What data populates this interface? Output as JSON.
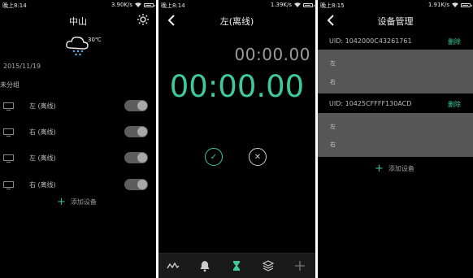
{
  "screen1": {
    "status": {
      "time": "晚上8:14",
      "speed": "3.90K/s"
    },
    "title": "中山",
    "weather": {
      "temp": "30℃"
    },
    "date": "2015/11/19",
    "group": "未分组",
    "devices": [
      {
        "label": "左 (离线)"
      },
      {
        "label": "右 (离线)"
      },
      {
        "label": "左 (离线)"
      },
      {
        "label": "右 (离线)"
      }
    ],
    "add_label": "添加设备"
  },
  "screen2": {
    "status": {
      "time": "晚上8:14",
      "speed": "1.39K/s"
    },
    "title": "左(离线)",
    "small_timer": "00:00.00",
    "big_timer": "00:00.00",
    "confirm_glyph": "✓",
    "cancel_glyph": "✕"
  },
  "screen3": {
    "status": {
      "time": "晚上8:15",
      "speed": "1.91K/s"
    },
    "title": "设备管理",
    "devices": [
      {
        "uid": "UID: 1042000C43261761",
        "delete": "删除",
        "left": "左",
        "right": "右"
      },
      {
        "uid": "UID: 10425CFFFF130ACD",
        "delete": "删除",
        "left": "左",
        "right": "右"
      }
    ],
    "add_label": "添加设备"
  },
  "colors": {
    "accent": "#3fc89b",
    "background": "#000000",
    "panel": "#565656"
  }
}
